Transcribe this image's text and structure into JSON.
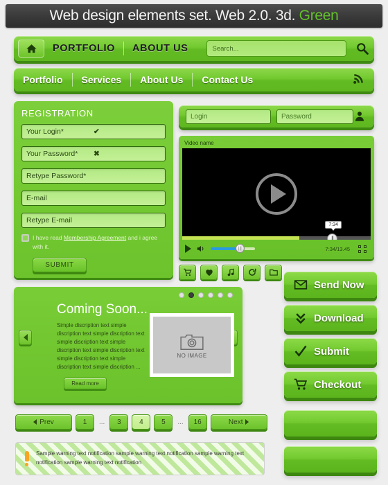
{
  "title": {
    "main": "Web design elements set. Web 2.0. 3d.",
    "accent": "Green"
  },
  "topnav": {
    "home_icon": "home-icon",
    "items": [
      "PORTFOLIO",
      "ABOUT US"
    ],
    "search_placeholder": "Search...",
    "search_icon": "search-icon"
  },
  "menubar": {
    "items": [
      "Portfolio",
      "Services",
      "About Us",
      "Contact Us"
    ],
    "rss_icon": "rss-icon"
  },
  "registration": {
    "heading": "REGISTRATION",
    "fields": [
      {
        "placeholder": "Your Login*",
        "status": "valid",
        "mark": "✔"
      },
      {
        "placeholder": "Your Password*",
        "status": "invalid",
        "mark": "✖"
      },
      {
        "placeholder": "Retype Password*",
        "status": "none",
        "mark": ""
      },
      {
        "placeholder": "E-mail",
        "status": "none",
        "mark": ""
      },
      {
        "placeholder": "Retype E-mail",
        "status": "none",
        "mark": ""
      }
    ],
    "agreement_pre": "I have read ",
    "agreement_link": "Membership Agreement",
    "agreement_post": " and i agree with it.",
    "submit_label": "SUBMIT"
  },
  "loginbar": {
    "login_placeholder": "Login",
    "password_placeholder": "Password",
    "user_icon": "user-icon"
  },
  "video": {
    "name": "Video name",
    "play_icon": "play-icon",
    "volume_icon": "volume-icon",
    "tooltip_time": "7:34",
    "time_display": "7:34/13.45",
    "fullscreen_icon": "fullscreen-icon",
    "progress_percent": 62,
    "volume_percent": 60
  },
  "icon_row": [
    {
      "name": "cart-icon"
    },
    {
      "name": "heart-icon"
    },
    {
      "name": "music-icon"
    },
    {
      "name": "refresh-icon"
    },
    {
      "name": "folder-icon"
    }
  ],
  "cta_buttons": [
    {
      "label": "Send Now",
      "icon": "envelope-icon"
    },
    {
      "label": "Download",
      "icon": "double-chevron-down-icon"
    },
    {
      "label": "Submit",
      "icon": "check-icon"
    },
    {
      "label": "Checkout",
      "icon": "cart-icon"
    },
    {
      "label": "",
      "icon": ""
    },
    {
      "label": "",
      "icon": ""
    }
  ],
  "slider": {
    "dots_total": 6,
    "dots_active_index": 1,
    "prev_icon": "chevron-left-icon",
    "next_icon": "chevron-right-icon",
    "title": "Coming Soon...",
    "description": "Simple discription text simple discription text simple discription text simple discription text simple discription text simple discription text simple discription text simple discription text simple discription ...",
    "read_more_label": "Read more",
    "image_placeholder_label": "NO IMAGE",
    "image_placeholder_icon": "camera-icon"
  },
  "pagination": {
    "prev_label": "Prev",
    "next_label": "Next",
    "ellipsis": "...",
    "pages": [
      "1",
      "3",
      "4",
      "5",
      "16"
    ],
    "active_page": "4"
  },
  "warning": {
    "icon": "exclamation-icon",
    "text": "Sample warning text notification sample warning text notification sample warning text notification sample warning text notification"
  }
}
